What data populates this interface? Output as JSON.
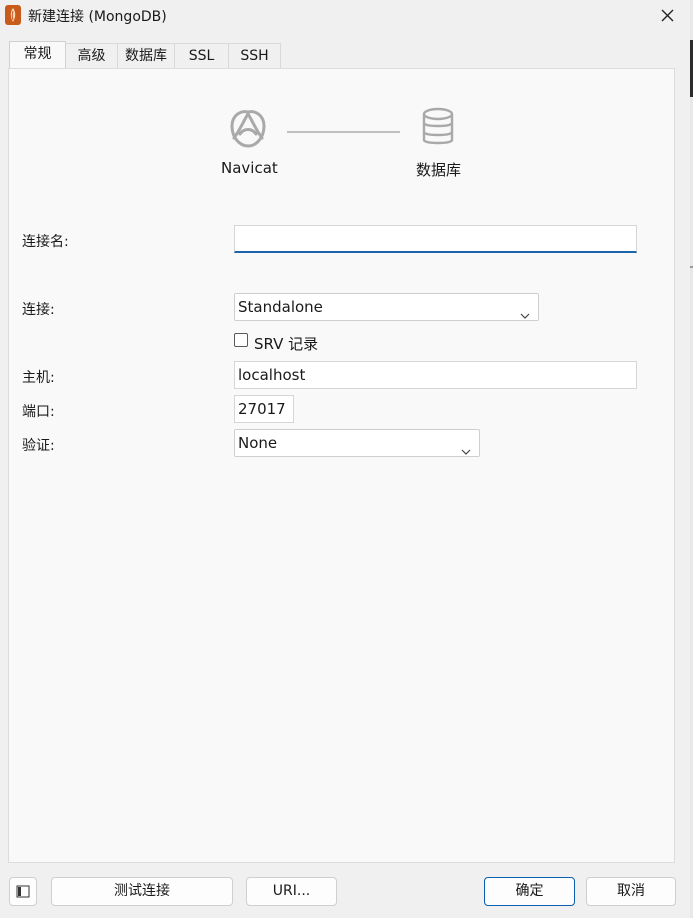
{
  "window": {
    "title": "新建连接 (MongoDB)"
  },
  "tabs": [
    {
      "label": "常规",
      "active": true
    },
    {
      "label": "高级",
      "active": false
    },
    {
      "label": "数据库",
      "active": false
    },
    {
      "label": "SSL",
      "active": false
    },
    {
      "label": "SSH",
      "active": false
    }
  ],
  "diagram": {
    "left_label": "Navicat",
    "right_label": "数据库"
  },
  "form": {
    "connection_name_label": "连接名:",
    "connection_name_value": "",
    "connection_label": "连接:",
    "connection_value": "Standalone",
    "srv_label": "SRV 记录",
    "srv_checked": false,
    "host_label": "主机:",
    "host_value": "localhost",
    "port_label": "端口:",
    "port_value": "27017",
    "auth_label": "验证:",
    "auth_value": "None"
  },
  "buttons": {
    "test": "测试连接",
    "uri": "URI...",
    "ok": "确定",
    "cancel": "取消"
  },
  "colors": {
    "accent": "#1e64ad",
    "app_icon": "#c85a1b"
  }
}
